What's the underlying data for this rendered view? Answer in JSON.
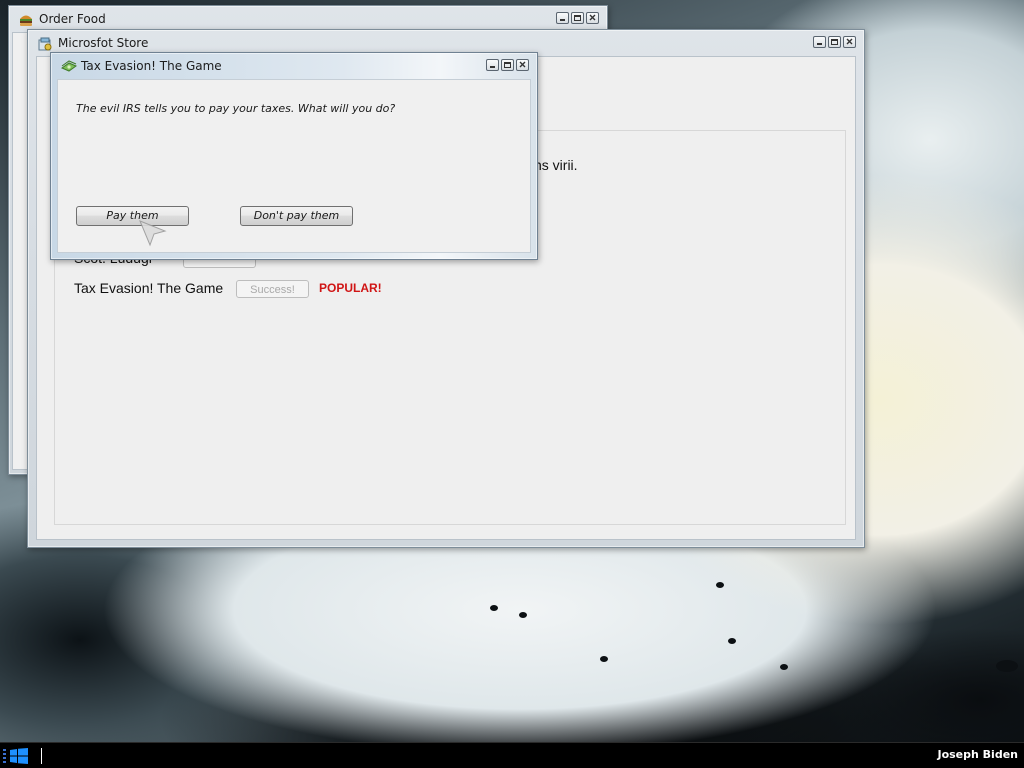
{
  "windows": {
    "order_food": {
      "title": "Order Food"
    },
    "store": {
      "title": "Microsfot Store",
      "partial_text_line1": "ns virii.",
      "partial_text_line2": "Scot. Ludugr",
      "items": [
        {
          "name": "Tax Evasion! The Game",
          "button_label": "Success!",
          "badge": "POPULAR!"
        }
      ]
    },
    "tax_dialog": {
      "title": "Tax Evasion! The Game",
      "message": "The evil IRS tells you to pay your taxes. What will you do?",
      "buttons": {
        "pay": "Pay them",
        "dont_pay": "Don't pay them"
      }
    }
  },
  "taskbar": {
    "user_name": "Joseph Biden"
  },
  "colors": {
    "popular_badge": "#d01515",
    "taskbar": "#000000",
    "start_logo": "#1e90ff"
  },
  "icons": {
    "order_food": "burger-icon",
    "store": "store-icon",
    "tax": "money-icon",
    "start": "windows-logo-icon"
  }
}
